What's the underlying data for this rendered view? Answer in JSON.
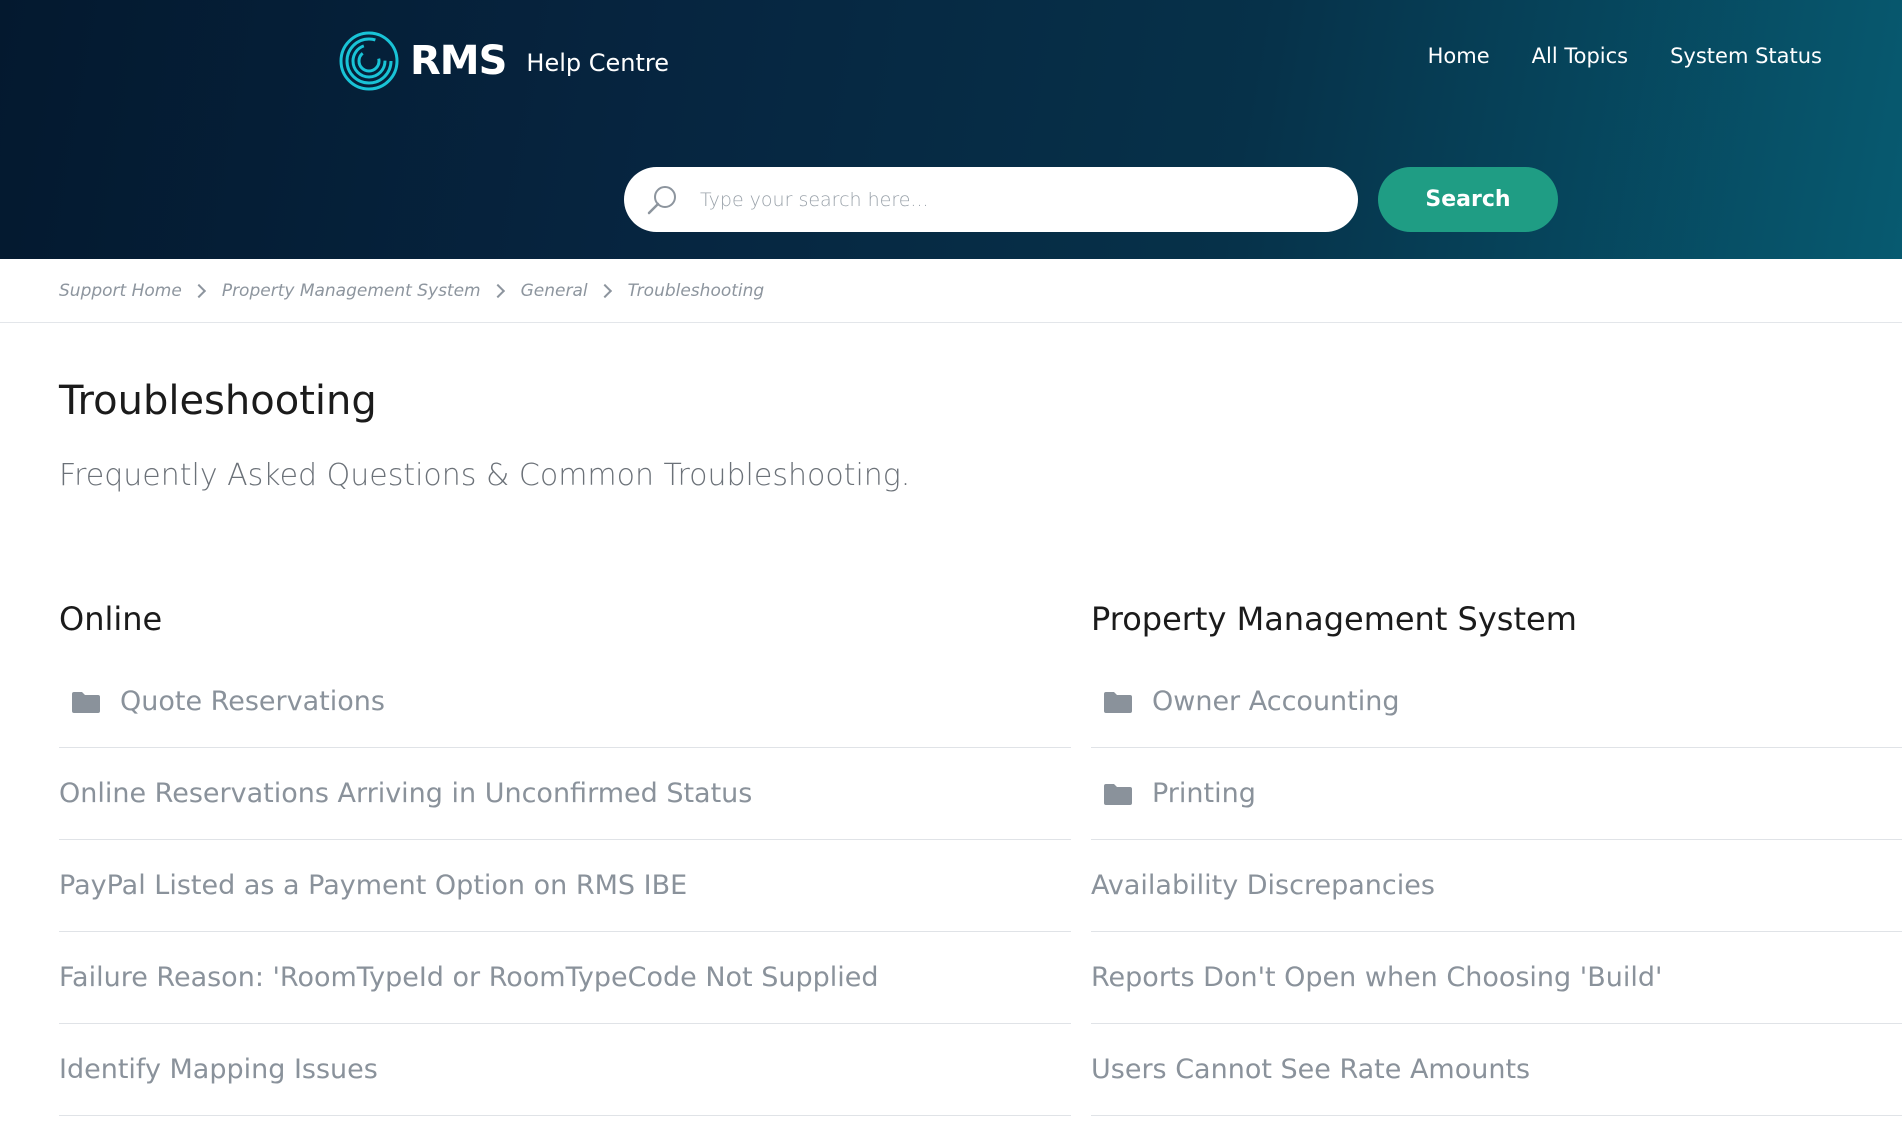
{
  "header": {
    "logo_text": "RMS",
    "logo_subtitle": "Help Centre",
    "nav": [
      {
        "label": "Home"
      },
      {
        "label": "All Topics"
      },
      {
        "label": "System Status"
      }
    ],
    "search": {
      "placeholder": "Type your search here...",
      "value": "",
      "button_label": "Search"
    }
  },
  "breadcrumb": [
    {
      "label": "Support Home"
    },
    {
      "label": "Property Management System"
    },
    {
      "label": "General"
    },
    {
      "label": "Troubleshooting"
    }
  ],
  "page": {
    "title": "Troubleshooting",
    "subtitle": "Frequently Asked Questions & Common Troubleshooting."
  },
  "columns": [
    {
      "title": "Online",
      "items": [
        {
          "label": "Quote Reservations",
          "icon": "folder-icon"
        },
        {
          "label": "Online Reservations Arriving in Unconfirmed Status"
        },
        {
          "label": "PayPal Listed as a Payment Option on RMS IBE"
        },
        {
          "label": "Failure Reason: 'RoomTypeId or RoomTypeCode Not Supplied"
        },
        {
          "label": "Identify Mapping Issues"
        }
      ]
    },
    {
      "title": "Property Management System",
      "items": [
        {
          "label": "Owner Accounting",
          "icon": "folder-icon"
        },
        {
          "label": "Printing",
          "icon": "folder-icon"
        },
        {
          "label": "Availability Discrepancies"
        },
        {
          "label": "Reports Don't Open when Choosing 'Build'"
        },
        {
          "label": "Users Cannot See Rate Amounts"
        }
      ]
    }
  ],
  "colors": {
    "header_start": "#04192f",
    "header_end": "#075a70",
    "accent": "#1f9d84",
    "logo_ring": "#19c3d6",
    "link_gray": "#8a929b"
  }
}
